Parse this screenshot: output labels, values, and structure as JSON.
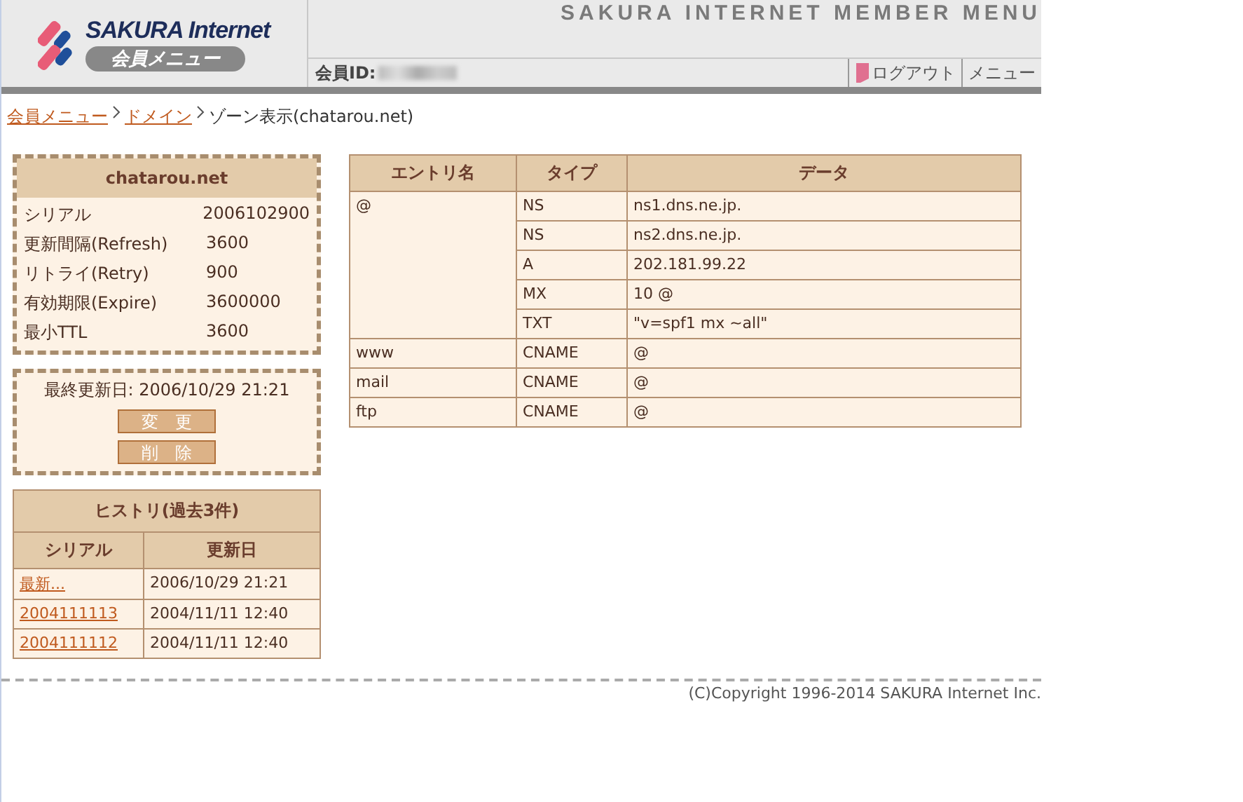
{
  "header": {
    "logo": {
      "brand": "SAKURA Internet",
      "subtitle": "会員メニュー"
    },
    "title": "SAKURA INTERNET MEMBER MENU",
    "member_id_label": "会員ID:",
    "nav": [
      {
        "label": "ログアウト",
        "kind": "logout"
      },
      {
        "label": "メニュー",
        "kind": "plain"
      }
    ]
  },
  "breadcrumb": [
    {
      "label": "会員メニュー",
      "kind": "link"
    },
    {
      "label": "ドメイン",
      "kind": "link"
    },
    {
      "label": "ゾーン表示(chatarou.net)",
      "kind": "current"
    }
  ],
  "zone_box": {
    "title": "chatarou.net",
    "rows": [
      {
        "label": "シリアル",
        "value": "2006102900"
      },
      {
        "label": "更新間隔(Refresh)",
        "value": "3600"
      },
      {
        "label": "リトライ(Retry)",
        "value": "900"
      },
      {
        "label": "有効期限(Expire)",
        "value": "3600000"
      },
      {
        "label": "最小TTL",
        "value": "3600"
      }
    ]
  },
  "update_box": {
    "last_updated": "最終更新日: 2006/10/29 21:21",
    "buttons": [
      "変　更",
      "削　除"
    ]
  },
  "history": {
    "title": "ヒストリ(過去3件)",
    "columns": [
      "シリアル",
      "更新日"
    ],
    "rows": [
      {
        "serial": "最新...",
        "date": "2006/10/29 21:21"
      },
      {
        "serial": "2004111113",
        "date": "2004/11/11 12:40"
      },
      {
        "serial": "2004111112",
        "date": "2004/11/11 12:40"
      }
    ]
  },
  "records": {
    "columns": [
      "エントリ名",
      "タイプ",
      "データ"
    ],
    "entries": [
      {
        "name": "@",
        "records": [
          {
            "type": "NS",
            "data": "ns1.dns.ne.jp."
          },
          {
            "type": "NS",
            "data": "ns2.dns.ne.jp."
          },
          {
            "type": "A",
            "data": "202.181.99.22"
          },
          {
            "type": "MX",
            "data": "10 @"
          },
          {
            "type": "TXT",
            "data": "\"v=spf1 mx ~all\""
          }
        ]
      },
      {
        "name": "www",
        "records": [
          {
            "type": "CNAME",
            "data": "@"
          }
        ]
      },
      {
        "name": "mail",
        "records": [
          {
            "type": "CNAME",
            "data": "@"
          }
        ]
      },
      {
        "name": "ftp",
        "records": [
          {
            "type": "CNAME",
            "data": "@"
          }
        ]
      }
    ]
  },
  "footer": {
    "copyright": "(C)Copyright 1996-2014 SAKURA Internet Inc."
  }
}
